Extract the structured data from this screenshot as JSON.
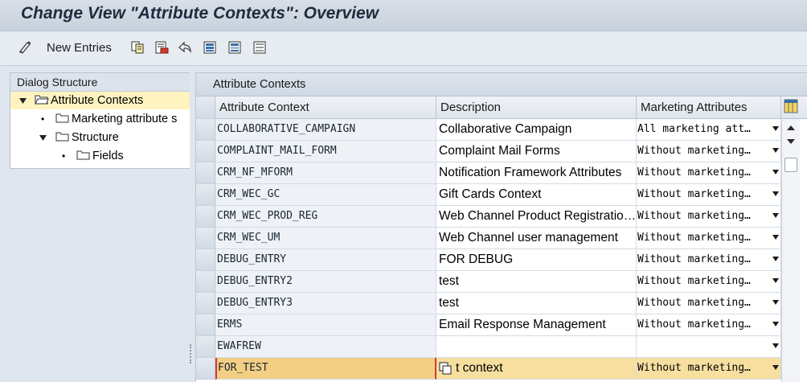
{
  "window": {
    "title": "Change View \"Attribute Contexts\": Overview"
  },
  "toolbar": {
    "new_entries_label": "New Entries",
    "icons": [
      "display-change-icon",
      "copy-icon",
      "delete-icon",
      "undo-icon",
      "select-all-icon",
      "select-block-icon",
      "deselect-all-icon"
    ]
  },
  "dialog_structure": {
    "header": "Dialog Structure",
    "items": [
      {
        "label": "Attribute Contexts",
        "level": 0,
        "expanded": true,
        "selected": true
      },
      {
        "label": "Marketing attribute s",
        "level": 1,
        "expanded": false,
        "selected": false
      },
      {
        "label": "Structure",
        "level": 1,
        "expanded": true,
        "selected": false
      },
      {
        "label": "Fields",
        "level": 2,
        "expanded": false,
        "selected": false
      }
    ]
  },
  "table": {
    "title": "Attribute Contexts",
    "columns": [
      "Attribute Context",
      "Description",
      "Marketing Attributes"
    ],
    "rows": [
      {
        "context": "COLLABORATIVE_CAMPAIGN",
        "description": "Collaborative Campaign",
        "marketing": "All marketing att…"
      },
      {
        "context": "COMPLAINT_MAIL_FORM",
        "description": "Complaint Mail Forms",
        "marketing": "Without marketing…"
      },
      {
        "context": "CRM_NF_MFORM",
        "description": "Notification Framework Attributes",
        "marketing": "Without marketing…"
      },
      {
        "context": "CRM_WEC_GC",
        "description": "Gift Cards Context",
        "marketing": "Without marketing…"
      },
      {
        "context": "CRM_WEC_PROD_REG",
        "description": "Web Channel Product Registratio…",
        "marketing": "Without marketing…"
      },
      {
        "context": "CRM_WEC_UM",
        "description": "Web Channel user management",
        "marketing": "Without marketing…"
      },
      {
        "context": "DEBUG_ENTRY",
        "description": "FOR DEBUG",
        "marketing": "Without marketing…"
      },
      {
        "context": "DEBUG_ENTRY2",
        "description": "test",
        "marketing": "Without marketing…"
      },
      {
        "context": "DEBUG_ENTRY3",
        "description": "test",
        "marketing": "Without marketing…"
      },
      {
        "context": "ERMS",
        "description": "Email Response Management",
        "marketing": "Without marketing…"
      },
      {
        "context": "EWAFREW",
        "description": "",
        "marketing": ""
      },
      {
        "context": "FOR_TEST",
        "description": "t context",
        "marketing": "Without marketing…"
      }
    ]
  },
  "colors": {
    "selected_row": "#f7dfa0",
    "tree_selected": "#fff3c0",
    "header_bg": "#dce3ec"
  }
}
